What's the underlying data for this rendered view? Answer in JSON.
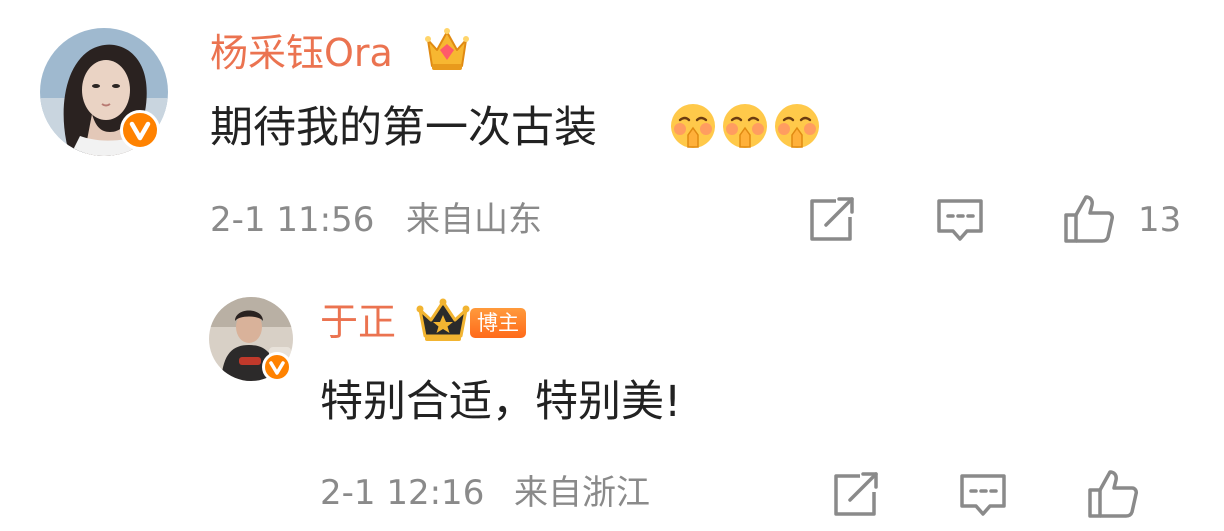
{
  "comment": {
    "username": "杨采钰Ora",
    "text": "期待我的第一次古装",
    "emoji_icon": "shush-face-emoji",
    "emoji_count": 3,
    "time": "2-1 11:56",
    "location": "来自山东",
    "like_count": "13",
    "accent_color": "#eb7350",
    "verified_color": "#ff8200"
  },
  "reply": {
    "username": "于正",
    "host_badge": "博主",
    "text": "特别合适，特别美!",
    "time": "2-1 12:16",
    "location": "来自浙江"
  }
}
